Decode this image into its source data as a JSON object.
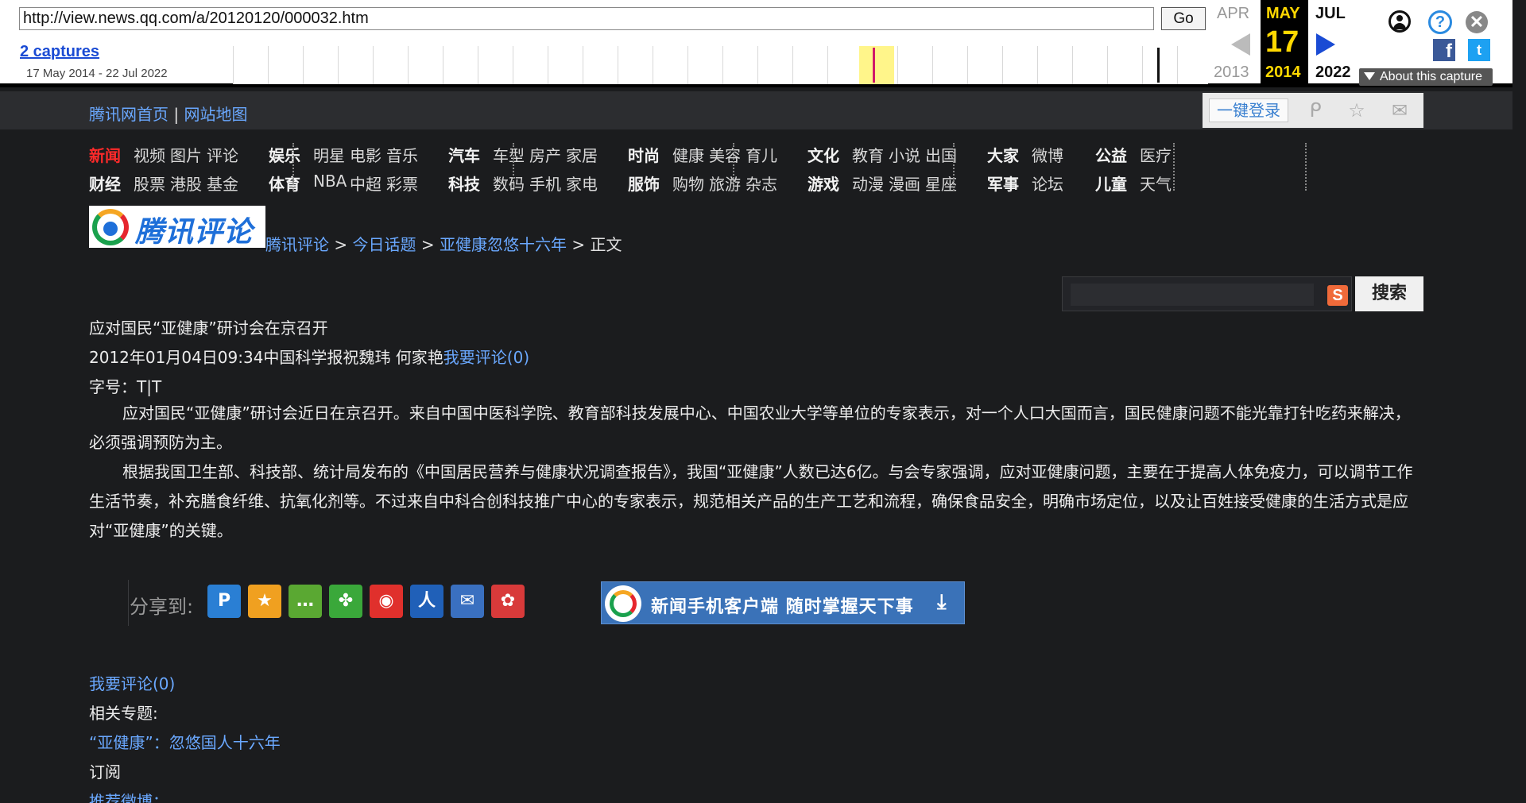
{
  "wayback": {
    "url": "http://view.news.qq.com/a/20120120/000032.htm",
    "go_label": "Go",
    "captures_label": "2 captures",
    "date_range": "17 May 2014 - 22 Jul 2022",
    "prev_month": "APR",
    "cur_month": "MAY",
    "next_month": "JUL",
    "cur_day": "17",
    "prev_year": "2013",
    "cur_year": "2014",
    "next_year": "2022",
    "about_label": "About this capture",
    "facebook_glyph": "f",
    "twitter_glyph": "t",
    "help_glyph": "?",
    "close_glyph": "✕",
    "icons": [
      "user-icon",
      "help-icon",
      "close-icon",
      "facebook-icon",
      "twitter-icon",
      "prev-arrow-icon",
      "next-arrow-icon"
    ]
  },
  "top": {
    "home_link": "腾讯网首页",
    "separator": "|",
    "sitemap_link": "网站地图",
    "login_label": "一键登录"
  },
  "nav": {
    "row1": [
      "新闻",
      "视频",
      "图片",
      "评论",
      "娱乐",
      "明星",
      "电影",
      "音乐",
      "汽车",
      "车型",
      "房产",
      "家居",
      "时尚",
      "健康",
      "美容",
      "育儿",
      "文化",
      "教育",
      "小说",
      "出国",
      "大家",
      "微博",
      "公益",
      "医疗"
    ],
    "row2": [
      "财经",
      "股票",
      "港股",
      "基金",
      "体育",
      "NBA",
      "中超",
      "彩票",
      "科技",
      "数码",
      "手机",
      "家电",
      "服饰",
      "购物",
      "旅游",
      "杂志",
      "游戏",
      "动漫",
      "漫画",
      "星座",
      "军事",
      "论坛",
      "儿童",
      "天气"
    ]
  },
  "logo_text": "腾讯评论",
  "breadcrumb": {
    "items": [
      "腾讯评论",
      "今日话题",
      "亚健康忽悠十六年"
    ],
    "current": "正文",
    "sep": " > "
  },
  "search": {
    "placeholder": "",
    "button_label": "搜索",
    "engine_glyph": "S"
  },
  "article": {
    "title": "应对国民“亚健康”研讨会在京召开",
    "meta": "2012年01月04日09:34中国科学报祝魏玮 何家艳",
    "comment_link": "我要评论(0)",
    "font_size": "字号：T|T",
    "para1": "应对国民“亚健康”研讨会近日在京召开。来自中国中医科学院、教育部科技发展中心、中国农业大学等单位的专家表示，对一个人口大国而言，国民健康问题不能光靠打针吃药来解决，必须强调预防为主。",
    "para2": "根据我国卫生部、科技部、统计局发布的《中国居民营养与健康状况调查报告》，我国“亚健康”人数已达6亿。与会专家强调，应对亚健康问题，主要在于提高人体免疫力，可以调节工作生活节奏，补充膳食纤维、抗氧化剂等。不过来自中科合创科技推广中心的专家表示，规范相关产品的生产工艺和流程，确保食品安全，明确市场定位，以及让百姓接受健康的生活方式是应对“亚健康”的关键。"
  },
  "share": {
    "label": "分享到:",
    "buttons": [
      {
        "name": "share-qzone-icon",
        "color": "#2a7fd4",
        "glyph": "P"
      },
      {
        "name": "share-favorite-icon",
        "color": "#f0a020",
        "glyph": "★"
      },
      {
        "name": "share-wechat-icon",
        "color": "#5aa832",
        "glyph": "…"
      },
      {
        "name": "share-pengyou-icon",
        "color": "#3aa83a",
        "glyph": "✤"
      },
      {
        "name": "share-weibo-icon",
        "color": "#e0302c",
        "glyph": "◉"
      },
      {
        "name": "share-renren-icon",
        "color": "#2060b8",
        "glyph": "人"
      },
      {
        "name": "share-email-icon",
        "color": "#3a70c0",
        "glyph": "✉"
      },
      {
        "name": "share-kaixin-icon",
        "color": "#d83a3a",
        "glyph": "✿"
      }
    ]
  },
  "app_banner": {
    "text": "新闻手机客户端  随时掌握天下事"
  },
  "bottom": {
    "comment_link": "我要评论(0)",
    "related_label": "相关专题:",
    "related_link": "“亚健康”：忽悠国人十六年",
    "subscribe": "订阅",
    "weibo": "推荐微博："
  },
  "colors": {
    "background": "#1b1c1e",
    "link": "#6aa8ff",
    "news_red": "#ff2a2a",
    "wayback_yellow": "#ffd800"
  }
}
